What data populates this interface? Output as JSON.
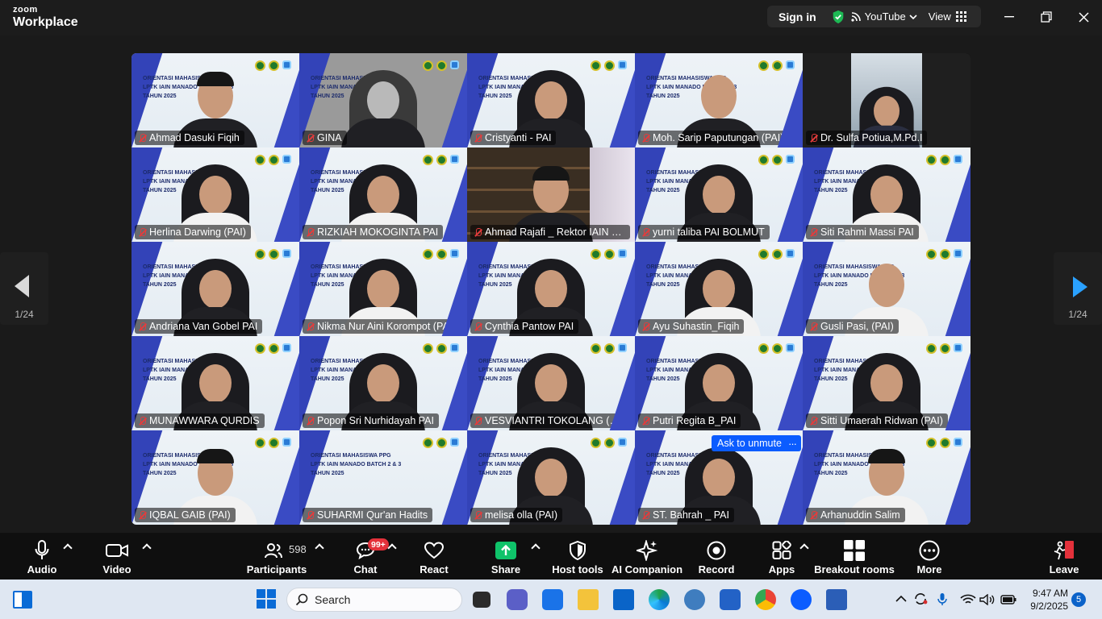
{
  "app": {
    "brand_small": "zoom",
    "brand_big": "Workplace"
  },
  "topbar": {
    "sign_in": "Sign in",
    "live": "YouTube",
    "view": "View"
  },
  "participants": [
    {
      "name": "Ahmad Dasuki Fiqih",
      "style": "slide",
      "look": "cap",
      "body": "dark"
    },
    {
      "name": "GINA",
      "style": "slide-gray",
      "look": "hijab",
      "body": "dark"
    },
    {
      "name": "Cristyanti - PAI",
      "style": "slide",
      "look": "hijab",
      "body": "dark"
    },
    {
      "name": "Moh. Sarip Paputungan (PAI)",
      "style": "slide",
      "look": "man",
      "body": "dark"
    },
    {
      "name": "Dr. Sulfa Potiua,M.Pd.I",
      "style": "black",
      "look": "hijab",
      "body": "navy"
    },
    {
      "name": "Herlina Darwing (PAI)",
      "style": "slide",
      "look": "hijab",
      "body": "white"
    },
    {
      "name": "RIZKIAH MOKOGINTA PAI",
      "style": "slide",
      "look": "hijab",
      "body": "white"
    },
    {
      "name": "Ahmad Rajafi _ Rektor IAIN Man...",
      "style": "speaker",
      "look": "cap",
      "body": "dark"
    },
    {
      "name": "yurni taliba PAI BOLMUT",
      "style": "slide",
      "look": "hijab",
      "body": "dark"
    },
    {
      "name": "Siti Rahmi Massi PAI",
      "style": "slide",
      "look": "hijab",
      "body": "white"
    },
    {
      "name": "Andriana Van Gobel PAI",
      "style": "slide",
      "look": "hijab",
      "body": "dark"
    },
    {
      "name": "Nikma Nur Aini Korompot (PAI)",
      "style": "slide",
      "look": "hijab",
      "body": "white"
    },
    {
      "name": "Cynthia Pantow PAI",
      "style": "slide",
      "look": "hijab",
      "body": "dark"
    },
    {
      "name": "Ayu Suhastin_Fiqih",
      "style": "slide",
      "look": "hijab",
      "body": "white"
    },
    {
      "name": "Gusli Pasi, (PAI)",
      "style": "slide",
      "look": "man",
      "body": "white"
    },
    {
      "name": "MUNAWWARA  QURDIS",
      "style": "slide",
      "look": "hijab",
      "body": "dark"
    },
    {
      "name": "Popon Sri Nurhidayah PAI",
      "style": "slide",
      "look": "hijab",
      "body": "dark"
    },
    {
      "name": "VESVIANTRI TOKOLANG (PAI)",
      "style": "slide",
      "look": "hijab",
      "body": "dark"
    },
    {
      "name": "Putri Regita B_PAI",
      "style": "slide",
      "look": "hijab",
      "body": "dark"
    },
    {
      "name": "Sitti Umaerah Ridwan (PAI)",
      "style": "slide",
      "look": "hijab",
      "body": "dark"
    },
    {
      "name": "IQBAL GAIB (PAI)",
      "style": "slide",
      "look": "cap",
      "body": "white"
    },
    {
      "name": "SUHARMI Qur'an Hadits",
      "style": "slide",
      "look": "none",
      "body": "white"
    },
    {
      "name": "melisa olla (PAI)",
      "style": "slide",
      "look": "hijab",
      "body": "dark"
    },
    {
      "name": "ST. Bahrah _ PAI",
      "style": "slide",
      "look": "hijab",
      "body": "dark"
    },
    {
      "name": "Arhanuddin Salim",
      "style": "slide",
      "look": "cap",
      "body": "white"
    }
  ],
  "slide_text": "ORIENTASI MAHASISWA PPG\nLPTK IAIN MANADO BATCH 2 & 3\nTAHUN 2025",
  "ask_to_unmute": "Ask to unmute",
  "pager": {
    "left": "1/24",
    "right": "1/24"
  },
  "toolbar": {
    "audio": "Audio",
    "video": "Video",
    "participants": "Participants",
    "participant_count": "598",
    "chat": "Chat",
    "chat_badge": "99+",
    "react": "React",
    "share": "Share",
    "host_tools": "Host tools",
    "ai_companion": "AI Companion",
    "record": "Record",
    "apps": "Apps",
    "breakout": "Breakout rooms",
    "more": "More",
    "leave": "Leave"
  },
  "taskbar": {
    "search_placeholder": "Search",
    "time": "9:47 AM",
    "date": "9/2/2025",
    "notifications": "5"
  },
  "colors": {
    "accent_blue": "#0b5cff",
    "leave_red": "#e4313b",
    "speaker_green": "#29c466",
    "share_green": "#0fc36a"
  }
}
